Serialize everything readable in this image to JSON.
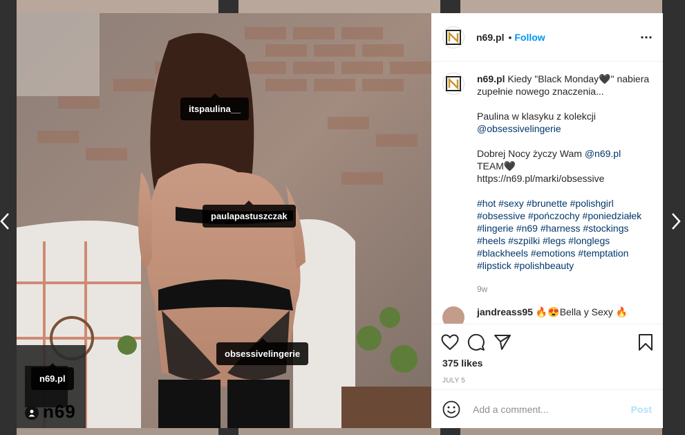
{
  "post": {
    "username": "n69.pl",
    "follow_label": "Follow",
    "dot": "•",
    "caption": {
      "username": "n69.pl",
      "line1": "Kiedy \"Black Monday🖤\" nabiera zupełnie nowego znaczenia...",
      "line2a": "Paulina w klasyku z kolekcji ",
      "mention1": "@obsessivelingerie",
      "line3a": "Dobrej Nocy życzy Wam ",
      "mention2": "@n69.pl",
      "line3b": " TEAM🖤",
      "url": "https://n69.pl/marki/obsessive",
      "hashtags": "#hot #sexy #brunette #polishgirl #obsessive #pończochy #poniedziałek #lingerie #n69 #harness #stockings #heels #szpilki #legs #longlegs #blackheels #emotions #temptation #lipstick #polishbeauty",
      "time": "9w"
    },
    "comment": {
      "username": "jandreass95",
      "text": " 🔥😍Bella y Sexy 🔥"
    },
    "likes": "375 likes",
    "date": "July 5",
    "add_comment_placeholder": "Add a comment...",
    "post_label": "Post"
  },
  "photo": {
    "tags": [
      "itspaulina__",
      "paulapastuszczak",
      "obsessivelingerie",
      "n69.pl"
    ],
    "watermark": "n69"
  },
  "icons": {
    "more": "more-horizontal-icon",
    "like": "heart-icon",
    "comment": "comment-bubble-icon",
    "share": "paper-plane-icon",
    "save": "bookmark-icon",
    "emoji": "emoji-smile-icon",
    "prev": "chevron-left-icon",
    "next": "chevron-right-icon",
    "user_tag": "user-icon"
  },
  "colors": {
    "accent": "#0095f6",
    "link": "#00376b",
    "post_disabled": "#b2dffc"
  }
}
